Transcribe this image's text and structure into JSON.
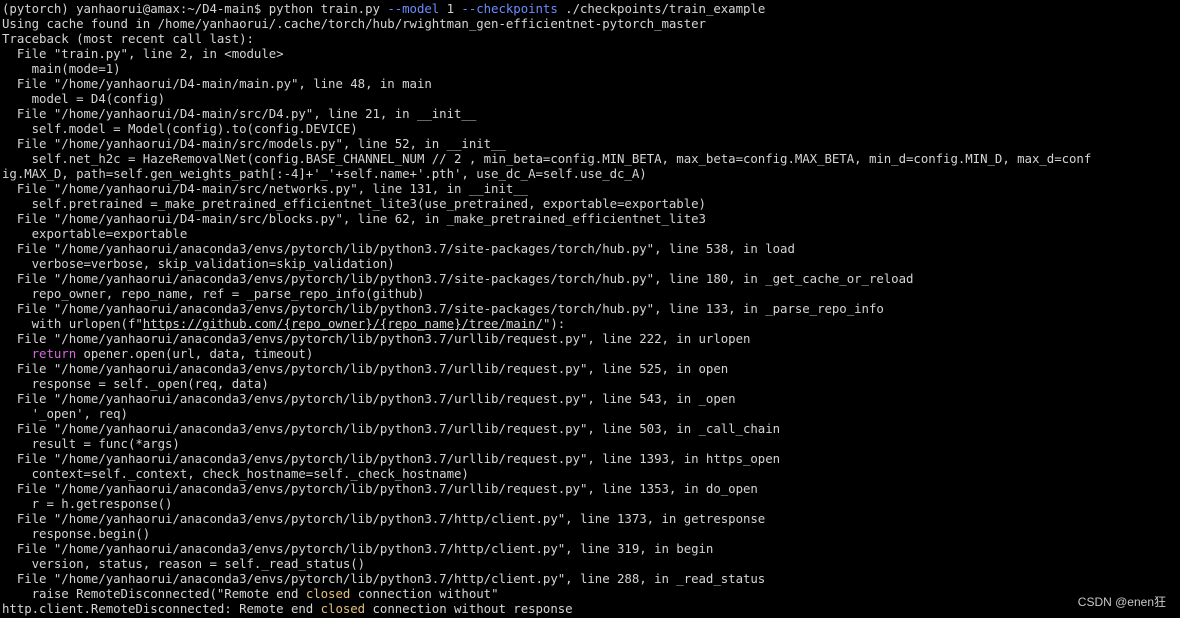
{
  "terminal": {
    "lines": [
      [
        {
          "t": "(pytorch) yanhaorui@amax:~/D4-main$ python train.py "
        },
        {
          "t": "--model",
          "c": "flag"
        },
        {
          "t": " 1 "
        },
        {
          "t": "--checkpoints",
          "c": "flag"
        },
        {
          "t": " ./checkpoints/train_example"
        }
      ],
      [
        {
          "t": "Using cache found in /home/yanhaorui/.cache/torch/hub/rwightman_gen-efficientnet-pytorch_master"
        }
      ],
      [
        {
          "t": "Traceback (most recent call last):"
        }
      ],
      [
        {
          "t": "  File \"train.py\", line 2, in <module>"
        }
      ],
      [
        {
          "t": "    main(mode=1)"
        }
      ],
      [
        {
          "t": "  File \"/home/yanhaorui/D4-main/main.py\", line 48, in main"
        }
      ],
      [
        {
          "t": "    model = D4(config)"
        }
      ],
      [
        {
          "t": "  File \"/home/yanhaorui/D4-main/src/D4.py\", line 21, in __init__"
        }
      ],
      [
        {
          "t": "    self.model = Model(config).to(config.DEVICE)"
        }
      ],
      [
        {
          "t": "  File \"/home/yanhaorui/D4-main/src/models.py\", line 52, in __init__"
        }
      ],
      [
        {
          "t": "    self.net_h2c = HazeRemovalNet(config.BASE_CHANNEL_NUM // 2 , min_beta=config.MIN_BETA, max_beta=config.MAX_BETA, min_d=config.MIN_D, max_d=conf"
        }
      ],
      [
        {
          "t": "ig.MAX_D, path=self.gen_weights_path[:-4]+'_'+self.name+'.pth', use_dc_A=self.use_dc_A)"
        }
      ],
      [
        {
          "t": "  File \"/home/yanhaorui/D4-main/src/networks.py\", line 131, in __init__"
        }
      ],
      [
        {
          "t": "    self.pretrained =_make_pretrained_efficientnet_lite3(use_pretrained, exportable=exportable)"
        }
      ],
      [
        {
          "t": "  File \"/home/yanhaorui/D4-main/src/blocks.py\", line 62, in _make_pretrained_efficientnet_lite3"
        }
      ],
      [
        {
          "t": "    exportable=exportable"
        }
      ],
      [
        {
          "t": "  File \"/home/yanhaorui/anaconda3/envs/pytorch/lib/python3.7/site-packages/torch/hub.py\", line 538, in load"
        }
      ],
      [
        {
          "t": "    verbose=verbose, skip_validation=skip_validation)"
        }
      ],
      [
        {
          "t": "  File \"/home/yanhaorui/anaconda3/envs/pytorch/lib/python3.7/site-packages/torch/hub.py\", line 180, in _get_cache_or_reload"
        }
      ],
      [
        {
          "t": "    repo_owner, repo_name, ref = _parse_repo_info(github)"
        }
      ],
      [
        {
          "t": "  File \"/home/yanhaorui/anaconda3/envs/pytorch/lib/python3.7/site-packages/torch/hub.py\", line 133, in _parse_repo_info"
        }
      ],
      [
        {
          "t": "    with urlopen(f\""
        },
        {
          "t": "https://github.com/{repo_owner}/{repo_name}/tree/main/",
          "c": "url"
        },
        {
          "t": "\"):"
        }
      ],
      [
        {
          "t": "  File \"/home/yanhaorui/anaconda3/envs/pytorch/lib/python3.7/urllib/request.py\", line 222, in urlopen"
        }
      ],
      [
        {
          "t": "    "
        },
        {
          "t": "return",
          "c": "kw"
        },
        {
          "t": " opener.open(url, data, timeout)"
        }
      ],
      [
        {
          "t": "  File \"/home/yanhaorui/anaconda3/envs/pytorch/lib/python3.7/urllib/request.py\", line 525, in open"
        }
      ],
      [
        {
          "t": "    response = self._open(req, data)"
        }
      ],
      [
        {
          "t": "  File \"/home/yanhaorui/anaconda3/envs/pytorch/lib/python3.7/urllib/request.py\", line 543, in _open"
        }
      ],
      [
        {
          "t": "    '_open', req)"
        }
      ],
      [
        {
          "t": "  File \"/home/yanhaorui/anaconda3/envs/pytorch/lib/python3.7/urllib/request.py\", line 503, in _call_chain"
        }
      ],
      [
        {
          "t": "    result = func(*args)"
        }
      ],
      [
        {
          "t": "  File \"/home/yanhaorui/anaconda3/envs/pytorch/lib/python3.7/urllib/request.py\", line 1393, in https_open"
        }
      ],
      [
        {
          "t": "    context=self._context, check_hostname=self._check_hostname)"
        }
      ],
      [
        {
          "t": "  File \"/home/yanhaorui/anaconda3/envs/pytorch/lib/python3.7/urllib/request.py\", line 1353, in do_open"
        }
      ],
      [
        {
          "t": "    r = h.getresponse()"
        }
      ],
      [
        {
          "t": "  File \"/home/yanhaorui/anaconda3/envs/pytorch/lib/python3.7/http/client.py\", line 1373, in getresponse"
        }
      ],
      [
        {
          "t": "    response.begin()"
        }
      ],
      [
        {
          "t": "  File \"/home/yanhaorui/anaconda3/envs/pytorch/lib/python3.7/http/client.py\", line 319, in begin"
        }
      ],
      [
        {
          "t": "    version, status, reason = self._read_status()"
        }
      ],
      [
        {
          "t": "  File \"/home/yanhaorui/anaconda3/envs/pytorch/lib/python3.7/http/client.py\", line 288, in _read_status"
        }
      ],
      [
        {
          "t": "    raise RemoteDisconnected(\"Remote end "
        },
        {
          "t": "closed",
          "c": "hl"
        },
        {
          "t": " connection without\""
        }
      ],
      [
        {
          "t": "http.client.RemoteDisconnected: Remote end "
        },
        {
          "t": "closed",
          "c": "hl"
        },
        {
          "t": " connection without response"
        }
      ]
    ]
  },
  "watermark": "CSDN @enen狂",
  "colors": {
    "background": "#000000",
    "text": "#d4d4d4",
    "flag": "#6b8cff",
    "keyword": "#d16ad6",
    "highlight": "#e5c07b"
  }
}
